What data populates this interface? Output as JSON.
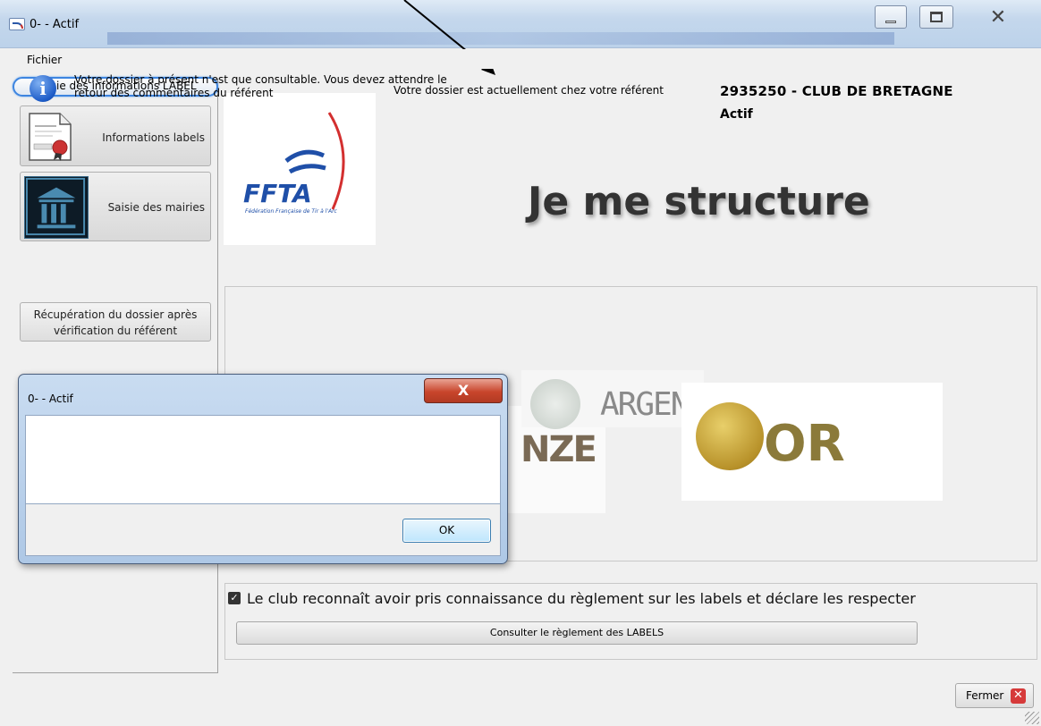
{
  "window": {
    "title": "0- - Actif",
    "controls": {
      "minimize": "minimize",
      "maximize": "maximize",
      "close": "✕"
    }
  },
  "menu": {
    "file": "Fichier"
  },
  "sidebar": {
    "header": "Saisie des informations LABEL",
    "items": [
      {
        "label": "Informations labels",
        "icon": "certificate-icon"
      },
      {
        "label": "Saisie des mairies",
        "icon": "town-hall-icon"
      }
    ],
    "recovery_button": "Récupération du dossier après vérification du référent"
  },
  "header": {
    "status_label": "Votre dossier est actuellement chez votre référent",
    "club_name": "2935250 - CLUB DE BRETAGNE",
    "club_status": "Actif",
    "title": "Je me structure",
    "logo_text": "FFTA",
    "logo_subtitle": "Fédération Française de Tir à l'Arc"
  },
  "labels": {
    "bronze": "NZE",
    "argent": "ARGENT",
    "or": "OR"
  },
  "rules": {
    "checked": true,
    "checkbox_label": "Le club reconnaît avoir pris connaissance du règlement sur les labels et déclare les respecter",
    "consult_button": "Consulter le règlement des LABELS"
  },
  "footer": {
    "close_button": "Fermer"
  },
  "dialog": {
    "title": "0- - Actif",
    "close": "X",
    "message": "Votre dossier à présent n'est que consultable. Vous devez attendre le retour des commentaires du référent",
    "ok_button": "OK"
  },
  "colors": {
    "accent_blue": "#3d85e0",
    "dialog_close_red": "#c8452c",
    "gold": "#b8922a",
    "ffta_blue": "#1f4fa8",
    "ffta_red": "#d32f2f"
  }
}
